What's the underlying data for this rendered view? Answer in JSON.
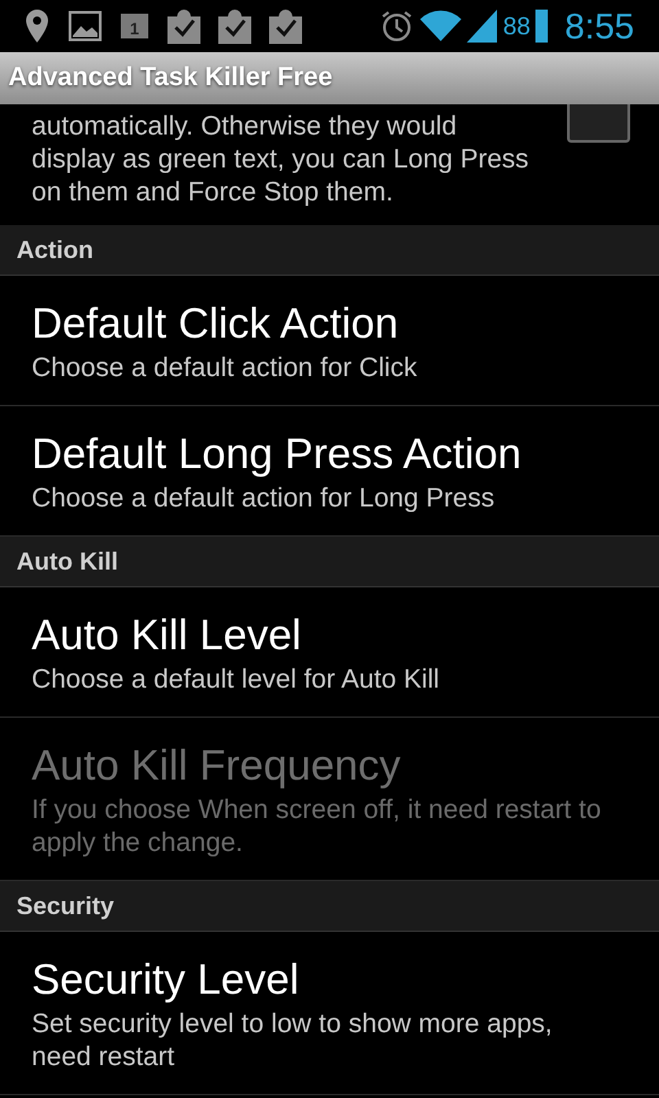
{
  "status_bar": {
    "calendar_day": "1",
    "battery": "88",
    "time": "8:55"
  },
  "title_bar": {
    "title": "Advanced Task Killer Free"
  },
  "partial_item": {
    "summary": "automatically. Otherwise they would display as green text, you can Long Press on them and Force Stop them.",
    "checked": false
  },
  "sections": [
    {
      "kind": "header",
      "title": "Action"
    },
    {
      "kind": "item",
      "title": "Default Click Action",
      "summary": "Choose a default action for Click",
      "disabled": false
    },
    {
      "kind": "item",
      "title": "Default Long Press Action",
      "summary": "Choose a default action for Long Press",
      "disabled": false
    },
    {
      "kind": "header",
      "title": "Auto Kill"
    },
    {
      "kind": "item",
      "title": "Auto Kill Level",
      "summary": "Choose a default level for Auto Kill",
      "disabled": false
    },
    {
      "kind": "item",
      "title": "Auto Kill Frequency",
      "summary": "If you choose When screen off, it need restart to apply the change.",
      "disabled": true
    },
    {
      "kind": "header",
      "title": "Security"
    },
    {
      "kind": "item",
      "title": "Security Level",
      "summary": "Set security level to low to show more apps, need restart",
      "disabled": false
    }
  ]
}
